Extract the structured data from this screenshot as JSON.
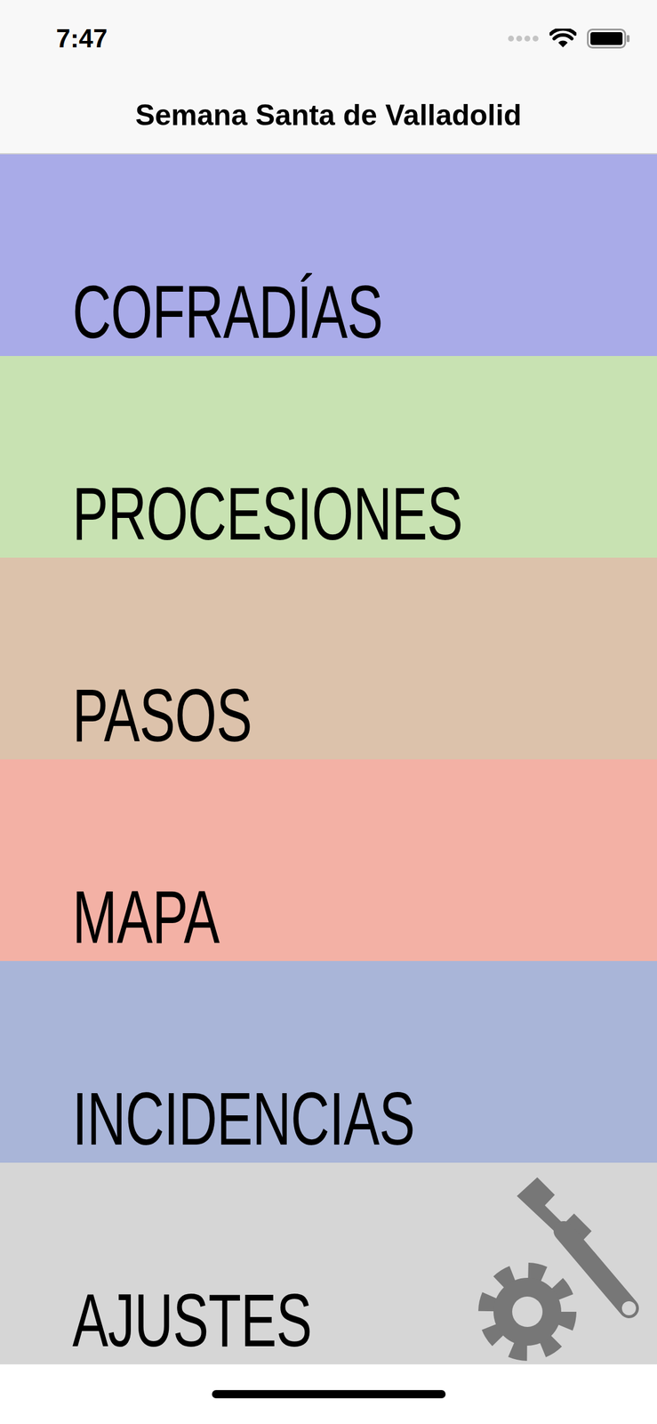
{
  "status_bar": {
    "time": "7:47"
  },
  "nav": {
    "title": "Semana Santa de Valladolid"
  },
  "tiles": [
    {
      "label": "COFRADÍAS",
      "color": "#a9abe8"
    },
    {
      "label": "PROCESIONES",
      "color": "#c8e2b2"
    },
    {
      "label": "PASOS",
      "color": "#dcc2ab"
    },
    {
      "label": "MAPA",
      "color": "#f3b1a5"
    },
    {
      "label": "INCIDENCIAS",
      "color": "#a9b5d8"
    },
    {
      "label": "AJUSTES",
      "color": "#d6d6d6"
    }
  ]
}
